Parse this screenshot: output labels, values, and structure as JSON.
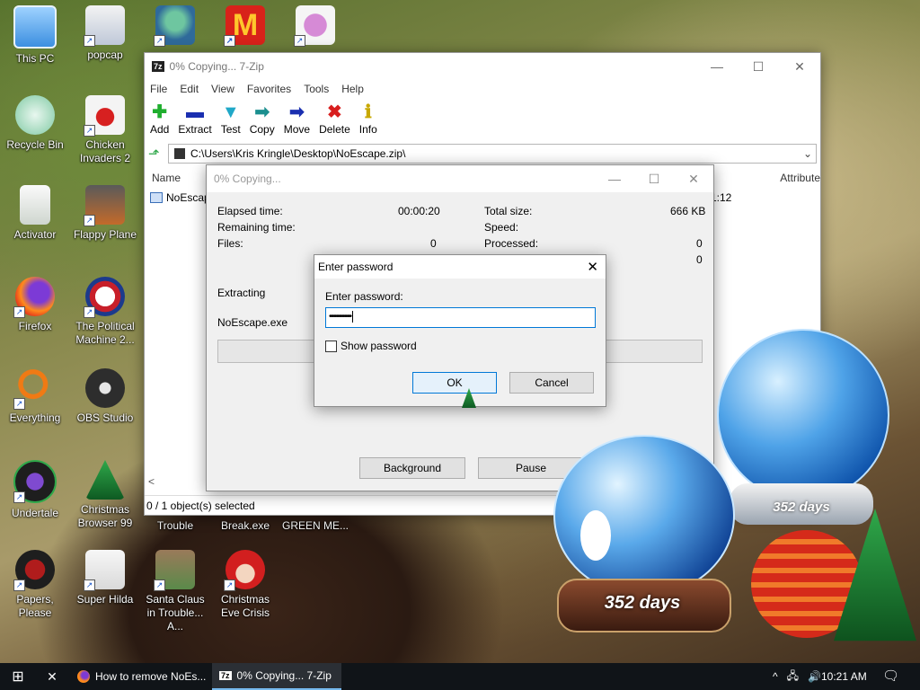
{
  "desktop": {
    "icons": [
      {
        "label": "This PC",
        "icon": "computer-icon"
      },
      {
        "label": "popcap",
        "icon": "folder-icon"
      },
      {
        "label": "Recycle Bin",
        "icon": "recycle-bin-icon"
      },
      {
        "label": "Chicken Invaders 2",
        "icon": "chicken-icon"
      },
      {
        "label": "Activator",
        "icon": "file-icon"
      },
      {
        "label": "Flappy Plane",
        "icon": "game-icon"
      },
      {
        "label": "Firefox",
        "icon": "firefox-icon"
      },
      {
        "label": "The Political Machine 2...",
        "icon": "political-machine-icon"
      },
      {
        "label": "Everything",
        "icon": "magnifier-icon"
      },
      {
        "label": "OBS Studio",
        "icon": "obs-icon"
      },
      {
        "label": "Undertale",
        "icon": "undertale-icon"
      },
      {
        "label": "Christmas Browser 99",
        "icon": "christmas-tree-icon"
      },
      {
        "label": "Papers, Please",
        "icon": "papers-please-icon"
      },
      {
        "label": "Super Hilda",
        "icon": "hilda-icon"
      },
      {
        "label": "Santa Claus in Trouble... A...",
        "icon": "santa-icon"
      },
      {
        "label": "Christmas Eve Crisis",
        "icon": "santa-face-icon"
      },
      {
        "label": "Trouble",
        "icon": "game-icon"
      },
      {
        "label": "Break.exe",
        "icon": "exe-icon"
      },
      {
        "label": "GREEN ME...",
        "icon": "file-icon"
      }
    ]
  },
  "zip_window": {
    "title": "0% Copying... 7-Zip",
    "app_icon": "7z",
    "menu": [
      "File",
      "Edit",
      "View",
      "Favorites",
      "Tools",
      "Help"
    ],
    "toolbar": [
      {
        "label": "Add",
        "icon": "plus-icon",
        "glyph": "✚",
        "color": "#1fae2e"
      },
      {
        "label": "Extract",
        "icon": "minus-icon",
        "glyph": "▬",
        "color": "#1a2fb0"
      },
      {
        "label": "Test",
        "icon": "test-icon",
        "glyph": "▼",
        "color": "#20a8c8"
      },
      {
        "label": "Copy",
        "icon": "copy-arrow-icon",
        "glyph": "➡",
        "color": "#1b8f8f"
      },
      {
        "label": "Move",
        "icon": "move-arrow-icon",
        "glyph": "➡",
        "color": "#1a2fb0"
      },
      {
        "label": "Delete",
        "icon": "delete-icon",
        "glyph": "✖",
        "color": "#d81e1e"
      },
      {
        "label": "Info",
        "icon": "info-icon",
        "glyph": "ℹ",
        "color": "#c8a800"
      }
    ],
    "path": "C:\\Users\\Kris Kringle\\Desktop\\NoEscape.zip\\",
    "columns": {
      "name": "Name",
      "attributes": "Attribute"
    },
    "file_name": "NoEscap",
    "file_time_fragment": "1:12",
    "status": "0 / 1 object(s) selected"
  },
  "progress_dialog": {
    "title": "0% Copying...",
    "elapsed_label": "Elapsed time:",
    "elapsed_value": "00:00:20",
    "remaining_label": "Remaining time:",
    "files_label": "Files:",
    "files_value": "0",
    "total_label": "Total size:",
    "total_value": "666 KB",
    "speed_label": "Speed:",
    "processed_label": "Processed:",
    "processed_value": "0",
    "extra_value": "0",
    "operation": "Extracting",
    "current_file": "NoEscape.exe",
    "progress": 0,
    "background_button": "Background",
    "pause_button": "Pause"
  },
  "password_dialog": {
    "title": "Enter password",
    "prompt": "Enter password:",
    "password_value": "••••••••••••••••",
    "show_password_label": "Show password",
    "show_password_checked": false,
    "ok_button": "OK",
    "cancel_button": "Cancel"
  },
  "decorations": {
    "globe_small_days": "352 days",
    "globe_large_days": "352 days"
  },
  "taskbar": {
    "start_icon": "windows-icon",
    "tasks": [
      {
        "label": "How to remove NoEs...",
        "icon": "firefox-icon"
      },
      {
        "label": "0% Copying... 7-Zip",
        "icon": "7zip-icon"
      }
    ],
    "clock": "10:21 AM"
  }
}
